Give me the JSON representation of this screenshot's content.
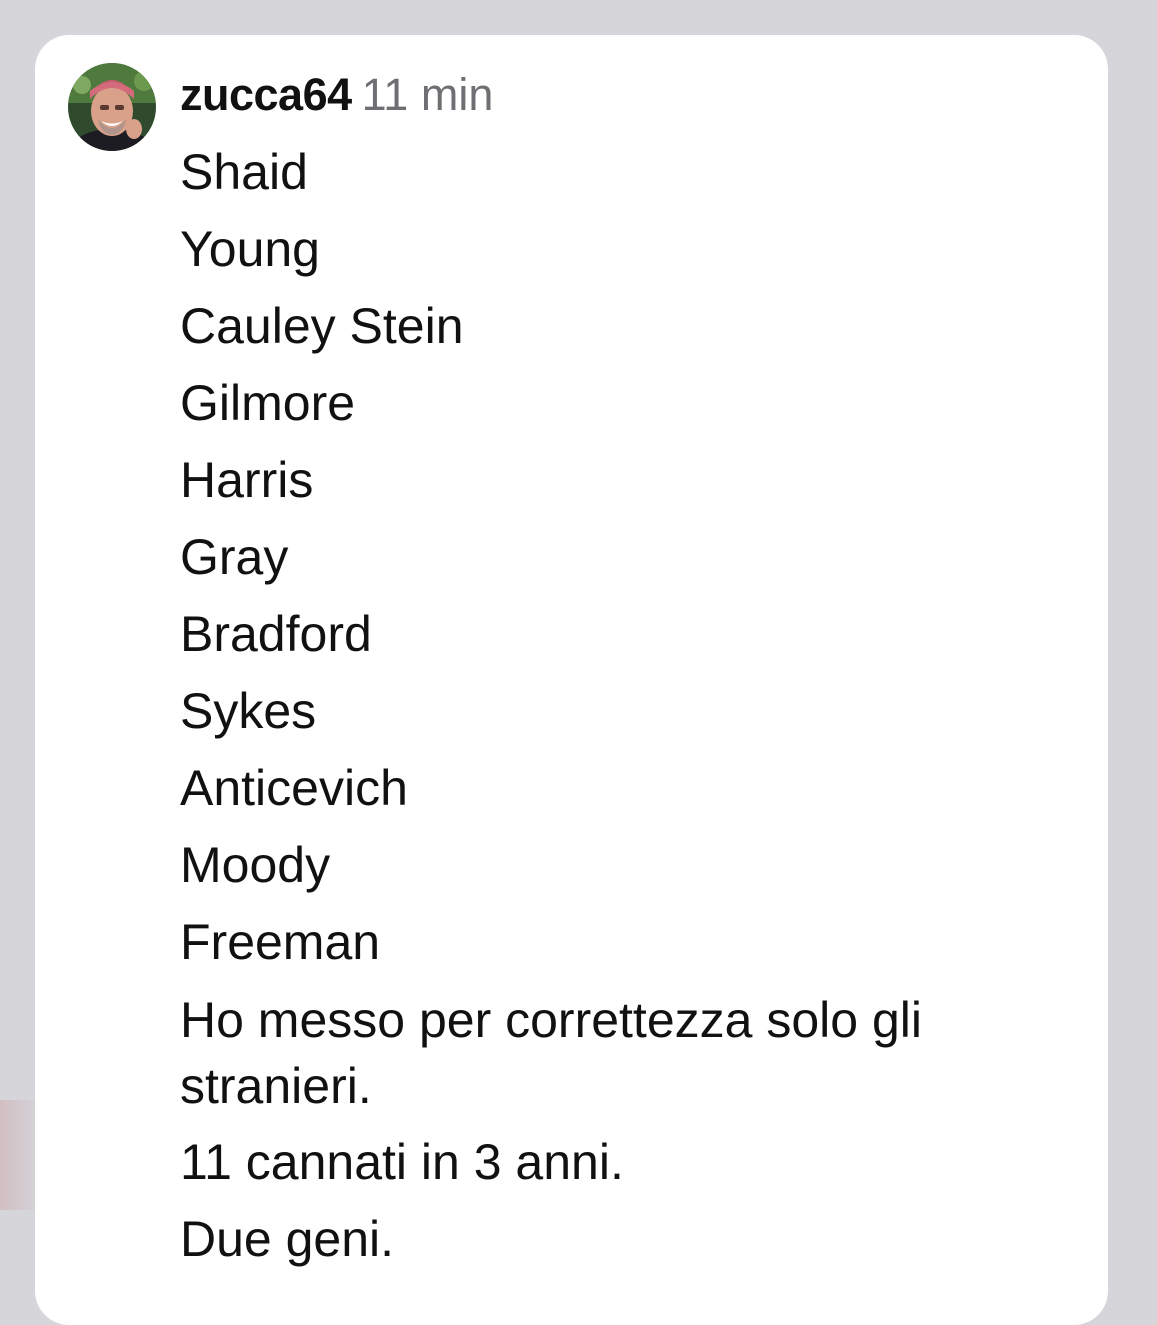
{
  "comment": {
    "username": "zucca64",
    "timestamp": "11 min",
    "avatar_icon": "user-avatar-photo",
    "lines": [
      "Shaid",
      "Young",
      "Cauley Stein",
      "Gilmore",
      "Harris",
      "Gray",
      "Bradford",
      "Sykes",
      "Anticevich",
      "Moody",
      "Freeman"
    ],
    "closing": [
      "Ho messo per correttezza solo gli stranieri.",
      "11 cannati in 3 anni.",
      "Due geni."
    ]
  },
  "colors": {
    "background": "#d5d5da",
    "card": "#ffffff",
    "text": "#111111",
    "timestamp": "#6e6e73"
  }
}
